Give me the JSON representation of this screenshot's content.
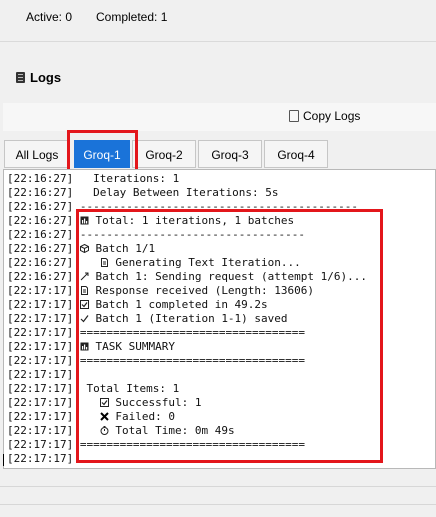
{
  "status": {
    "active": "Active: 0",
    "completed": "Completed: 1"
  },
  "logs_section": {
    "title": "Logs",
    "copy_button": "Copy Logs"
  },
  "tabs": [
    {
      "label": "All Logs",
      "active": false
    },
    {
      "label": "Groq-1",
      "active": true
    },
    {
      "label": "Groq-2",
      "active": false
    },
    {
      "label": "Groq-3",
      "active": false
    },
    {
      "label": "Groq-4",
      "active": false
    }
  ],
  "log_lines": [
    {
      "time": "[22:16:27]",
      "text": "   Iterations: 1"
    },
    {
      "time": "[22:16:27]",
      "text": "   Delay Between Iterations: 5s"
    },
    {
      "time": "[22:16:27]",
      "text": " ------------------------------------------"
    },
    {
      "time": "[22:16:27]",
      "icon": "chart-icon",
      "text": "Total: 1 iterations, 1 batches"
    },
    {
      "time": "[22:16:27]",
      "text": " ----------------------------------"
    },
    {
      "time": "[22:16:27]",
      "icon": "package-icon",
      "text": "Batch 1/1"
    },
    {
      "time": "[22:16:27]",
      "indent": true,
      "icon": "doc-icon",
      "text": "Generating Text Iteration..."
    },
    {
      "time": "[22:16:27]",
      "icon": "send-icon",
      "text": "Batch 1: Sending request (attempt 1/6)..."
    },
    {
      "time": "[22:17:17]",
      "icon": "doc-icon",
      "text": "Response received (Length: 13606)"
    },
    {
      "time": "[22:17:17]",
      "icon": "checkbox-icon",
      "text": "Batch 1 completed in 49.2s"
    },
    {
      "time": "[22:17:17]",
      "icon": "checkmark-icon",
      "text": "Batch 1 (Iteration 1-1) saved"
    },
    {
      "time": "[22:17:17]",
      "text": " =================================="
    },
    {
      "time": "[22:17:17]",
      "icon": "chart-icon",
      "text": "TASK SUMMARY"
    },
    {
      "time": "[22:17:17]",
      "text": " =================================="
    },
    {
      "time": "[22:17:17]",
      "text": ""
    },
    {
      "time": "[22:17:17]",
      "text": "  Total Items: 1"
    },
    {
      "time": "[22:17:17]",
      "indent": true,
      "icon": "checkbox-icon",
      "text": "Successful: 1"
    },
    {
      "time": "[22:17:17]",
      "indent": true,
      "icon": "cross-icon",
      "text": "Failed: 0"
    },
    {
      "time": "[22:17:17]",
      "indent": true,
      "icon": "timer-icon",
      "text": "Total Time: 0m 49s"
    },
    {
      "time": "[22:17:17]",
      "text": " =================================="
    },
    {
      "time": "[22:17:17]",
      "text": ""
    }
  ]
}
